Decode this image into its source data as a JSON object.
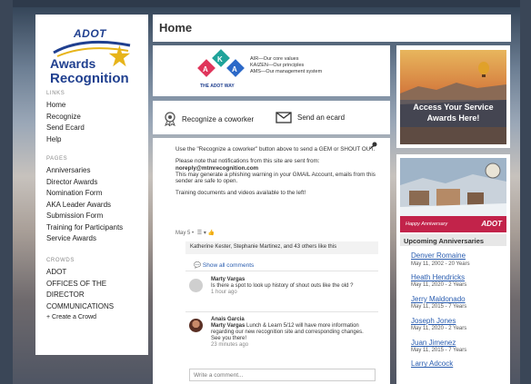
{
  "header": {
    "title": "Home"
  },
  "logo": {
    "adot": "ADOT",
    "line1": "Awards",
    "line2": "Recognition"
  },
  "sidebar": {
    "links_head": "LINKS",
    "links": [
      "Home",
      "Recognize",
      "Send Ecard",
      "Help"
    ],
    "pages_head": "PAGES",
    "pages": [
      "Anniversaries",
      "Director Awards",
      "Nomination Form",
      "AKA Leader Awards",
      "Submission Form",
      "Training for Participants",
      "Service Awards"
    ],
    "crowds_head": "CROWDS",
    "crowds": [
      "ADOT",
      "OFFICES OF THE",
      "DIRECTOR",
      "COMMUNICATIONS"
    ],
    "create_crowd": "+ Create a Crowd"
  },
  "aka": {
    "line1": "AIR—Our core values",
    "line2": "KAIZEN—Our principles",
    "line3": "AMS—Our management system",
    "sub": "THE ADOT WAY"
  },
  "actions": {
    "recognize": "Recognize a coworker",
    "ecard": "Send an ecard"
  },
  "feed": {
    "p1": "Use the \"Recognize a coworker\" button above to send a GEM or SHOUT OUT.",
    "p2a": "Please note that notifications from this site are sent from:",
    "p2b": "noreply@mtmrecognition.com",
    "p2c": "This may generate a phishing warning in your GMAIL Account, emails from this sender are safe to open.",
    "p3": "Training documents and videos available to the left!",
    "meta": "May 5 •",
    "likes": "Katherine Kester, Stephanie Martinez, and 43 others like this",
    "show_comments": "Show all comments",
    "comments": [
      {
        "name": "Marty Vargas",
        "text": "Is there a spot to look up history of shout outs like the old ?",
        "time": "1 hour ago"
      },
      {
        "name": "Anais Garcia",
        "text_lead": "Marty Vargas",
        "text": " Lunch & Learn 5/12 will have more information regarding our new recognition site and corresponding changes. See you there!",
        "time": "23 minutes ago"
      }
    ],
    "write_placeholder": "Write a comment..."
  },
  "promo": {
    "title_line1": "Access Your Service",
    "title_line2": "Awards Here!"
  },
  "anniversaries": {
    "banner_text": "Happy Anniversary",
    "banner_brand": "ADOT",
    "heading": "Upcoming Anniversaries",
    "items": [
      {
        "name": "Denver Romaine",
        "date": "May 11, 2002 - 20 Years"
      },
      {
        "name": "Heath Hendricks",
        "date": "May 11, 2020 - 2 Years"
      },
      {
        "name": "Jerry Maldonado",
        "date": "May 11, 2015 - 7 Years"
      },
      {
        "name": "Joseph Jones",
        "date": "May 11, 2020 - 2 Years"
      },
      {
        "name": "Juan Jimenez",
        "date": "May 11, 2015 - 7 Years"
      },
      {
        "name": "Larry Adcock",
        "date": ""
      }
    ]
  },
  "colors": {
    "brand_blue": "#1f3f8f",
    "link_blue": "#2a5db0",
    "aka_red": "#e0355b",
    "aka_teal": "#1fa39a",
    "aka_blue": "#2c69c8"
  }
}
